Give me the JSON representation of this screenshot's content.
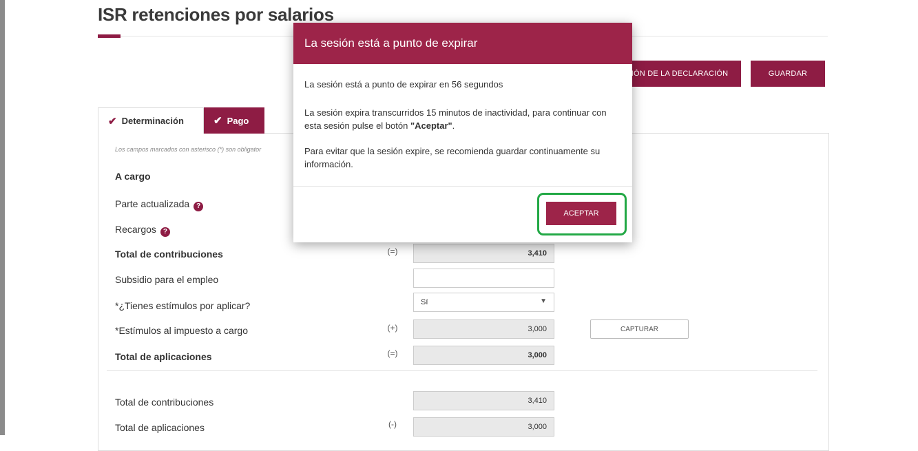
{
  "page": {
    "title": "ISR retenciones por salarios",
    "buttons": {
      "validate": "CIÓN DE LA DECLARACIÓN",
      "save": "GUARDAR"
    },
    "tabs": [
      {
        "label": "Determinación",
        "active": false
      },
      {
        "label": "Pago",
        "active": true
      }
    ],
    "note": "Los campos marcados con asterisco (*) son obligator",
    "rows": {
      "a_cargo": "A cargo",
      "parte_actualizada": "Parte actualizada",
      "recargos": "Recargos",
      "total_contribuciones": {
        "label": "Total de contribuciones",
        "sign": "(=)",
        "value": "3,410"
      },
      "subsidio": {
        "label": "Subsidio para el empleo",
        "value": ""
      },
      "estimulos_q": {
        "label": "*¿Tienes estímulos por aplicar?",
        "selected": "Sí"
      },
      "estimulos_impuesto": {
        "label": "*Estímulos al impuesto a cargo",
        "sign": "(+)",
        "value": "3,000",
        "button": "CAPTURAR"
      },
      "total_aplicaciones": {
        "label": "Total de aplicaciones",
        "sign": "(=)",
        "value": "3,000"
      },
      "summary_contribuciones": {
        "label": "Total de contribuciones",
        "value": "3,410"
      },
      "summary_aplicaciones": {
        "label": "Total de aplicaciones",
        "sign": "(-)",
        "value": "3,000"
      }
    }
  },
  "modal": {
    "title": "La sesión está a punto de expirar",
    "line1": "La sesión está a punto de expirar en 56 segundos",
    "line2_a": "La sesión expira transcurridos 15 minutos de inactividad, para continuar con esta sesión pulse el botón ",
    "line2_bold": "\"Aceptar\"",
    "line2_end": ".",
    "line3": "Para evitar que la sesión expire, se recomienda guardar continuamente su información.",
    "accept": "ACEPTAR"
  },
  "colors": {
    "brand": "#9d2449",
    "highlight": "#22a845"
  },
  "icons": {
    "help": "question-circle-icon",
    "check": "check-icon",
    "select_arrow": "chevron-down-icon"
  }
}
